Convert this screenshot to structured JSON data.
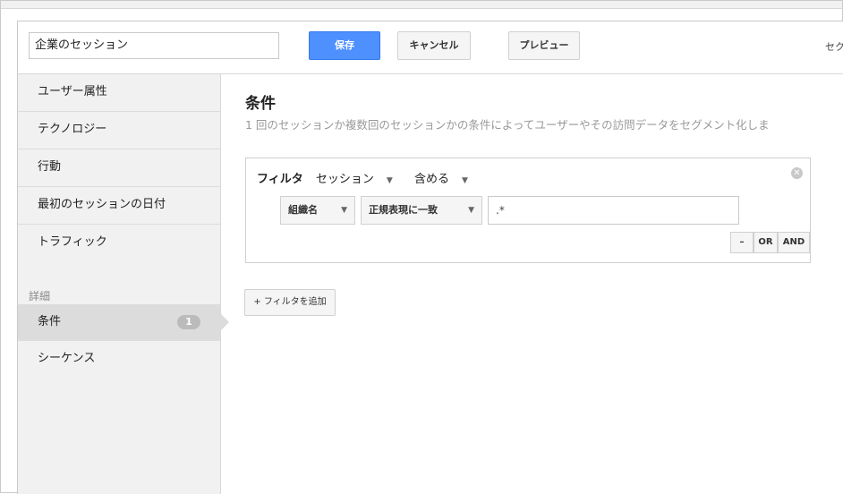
{
  "header": {
    "segment_name": "企業のセッション",
    "save_label": "保存",
    "cancel_label": "キャンセル",
    "preview_label": "プレビュー",
    "right_text": "セク"
  },
  "sidebar": {
    "items": [
      {
        "label": "ユーザー属性"
      },
      {
        "label": "テクノロジー"
      },
      {
        "label": "行動"
      },
      {
        "label": "最初のセッションの日付"
      },
      {
        "label": "トラフィック"
      }
    ],
    "section_label": "詳細",
    "advanced": [
      {
        "label": "条件",
        "badge": "1"
      },
      {
        "label": "シーケンス"
      }
    ]
  },
  "main": {
    "title": "条件",
    "description": "1 回のセッションか複数回のセッションかの条件によってユーザーやその訪問データをセグメント化しま",
    "filter": {
      "filter_label": "フィルタ",
      "scope": "セッション",
      "mode": "含める",
      "dimension": "組織名",
      "match_type": "正規表現に一致",
      "value": ".*",
      "minus_label": "–",
      "or_label": "OR",
      "and_label": "AND"
    },
    "add_filter_label": "+ フィルタを追加"
  },
  "icons": {
    "close": "close-icon",
    "caret": "chevron-down-icon"
  },
  "colors": {
    "primary": "#4d90fe",
    "sidebar_bg": "#f1f1f1",
    "active_bg": "#dcdcdc"
  }
}
